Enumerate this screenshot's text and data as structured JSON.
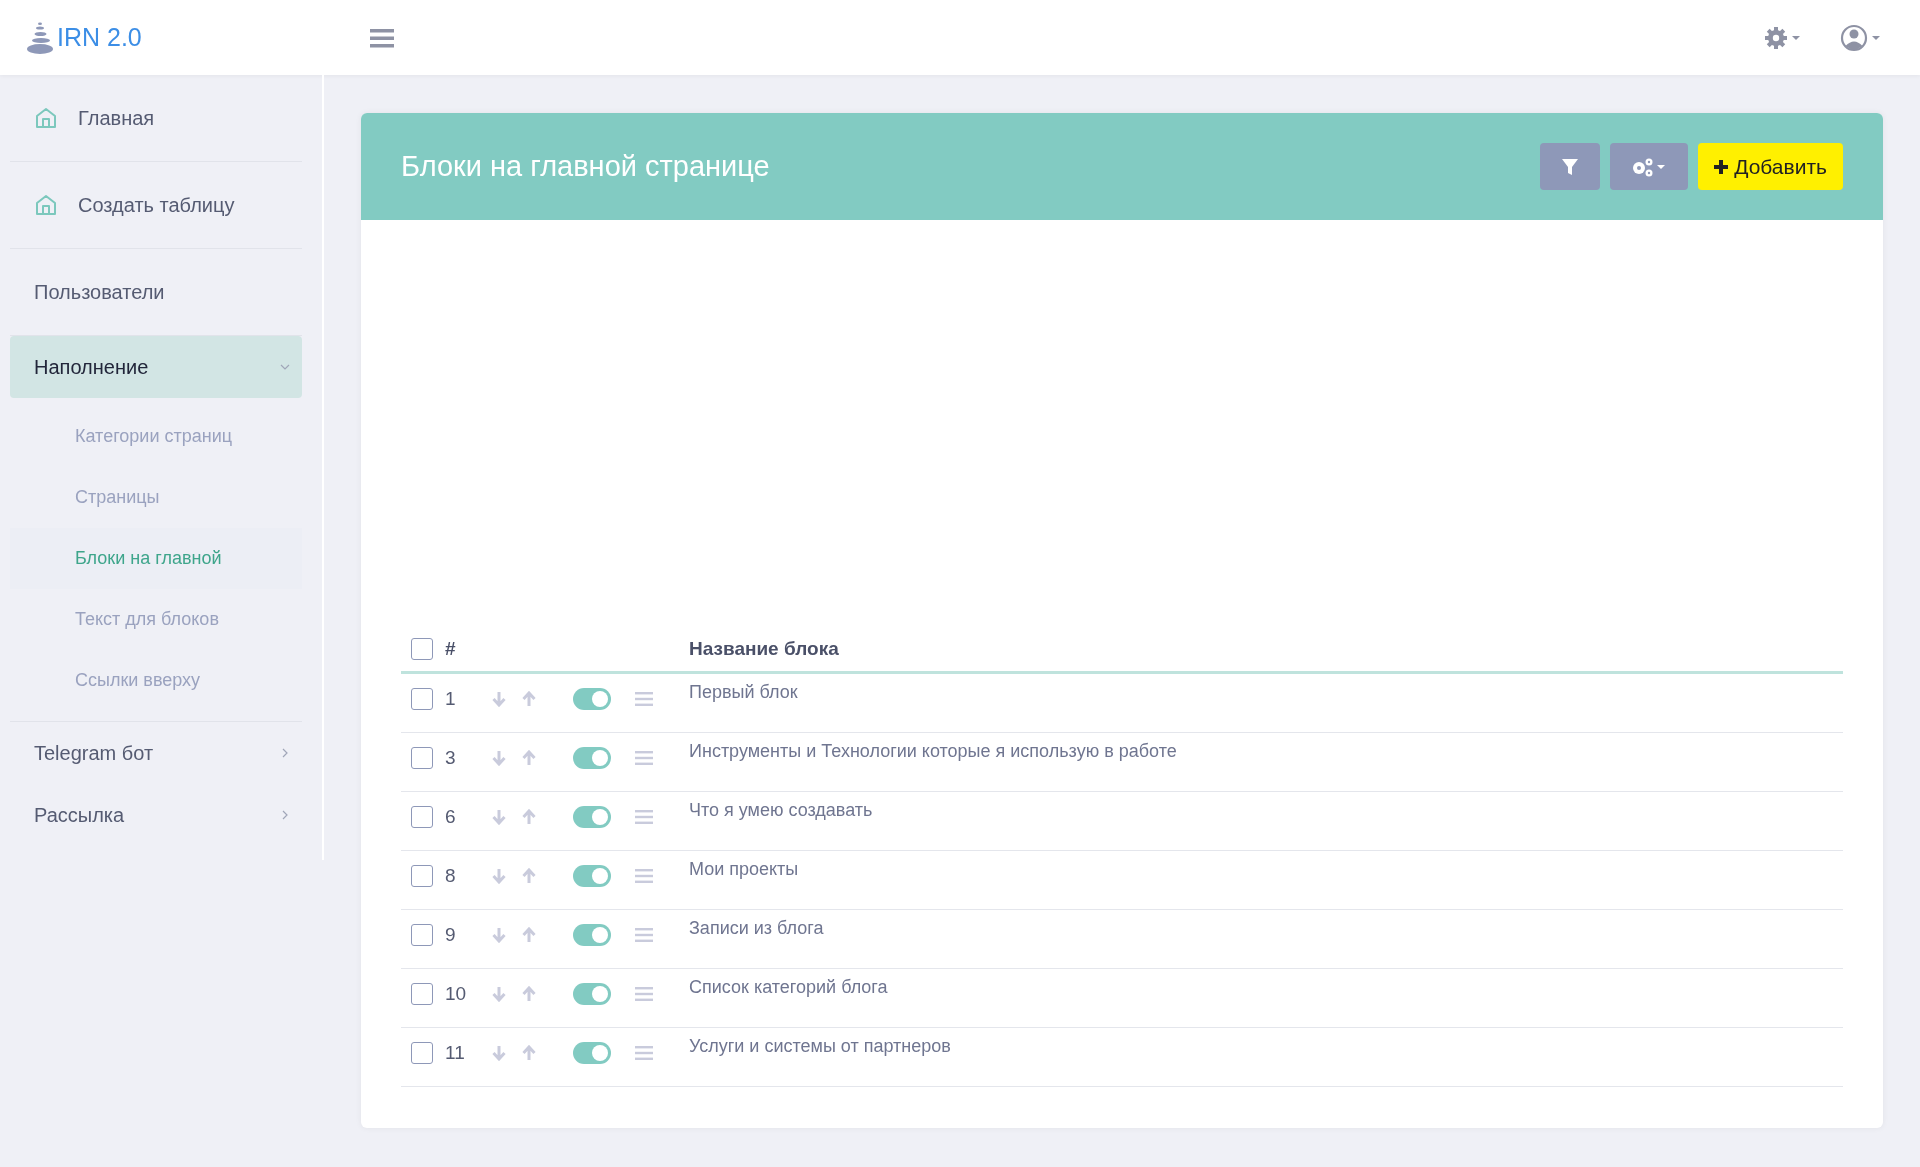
{
  "topbar": {
    "logo_text": "IRN 2.0"
  },
  "sidebar": {
    "items": [
      {
        "kind": "icon-link",
        "label": "Главная"
      },
      {
        "kind": "icon-link",
        "label": "Создать таблицу"
      },
      {
        "kind": "link",
        "label": "Пользователи"
      },
      {
        "kind": "group",
        "label": "Наполнение",
        "expanded": true,
        "children": [
          {
            "label": "Категории страниц",
            "selected": false
          },
          {
            "label": "Страницы",
            "selected": false
          },
          {
            "label": "Блоки на главной",
            "selected": true
          },
          {
            "label": "Текст для блоков",
            "selected": false
          },
          {
            "label": "Ссылки вверху",
            "selected": false
          }
        ]
      },
      {
        "kind": "group",
        "label": "Telegram бот",
        "expanded": false
      },
      {
        "kind": "group",
        "label": "Рассылка",
        "expanded": false
      }
    ]
  },
  "card": {
    "title": "Блоки на главной странице",
    "add_button": "Добавить"
  },
  "table": {
    "select_all": {
      "checked": false
    },
    "columns": [
      "#",
      "Название блока"
    ],
    "rows": [
      {
        "checked": false,
        "number": "1",
        "on": true,
        "name": "Первый блок"
      },
      {
        "checked": false,
        "number": "3",
        "on": true,
        "name": "Инструменты и Технологии которые я использую в работе"
      },
      {
        "checked": false,
        "number": "6",
        "on": true,
        "name": "Что я умею создавать"
      },
      {
        "checked": false,
        "number": "8",
        "on": true,
        "name": "Мои проекты"
      },
      {
        "checked": false,
        "number": "9",
        "on": true,
        "name": "Записи из блога"
      },
      {
        "checked": false,
        "number": "10",
        "on": true,
        "name": "Список категорий блога"
      },
      {
        "checked": false,
        "number": "11",
        "on": true,
        "name": "Услуги и системы от партнеров"
      }
    ]
  }
}
